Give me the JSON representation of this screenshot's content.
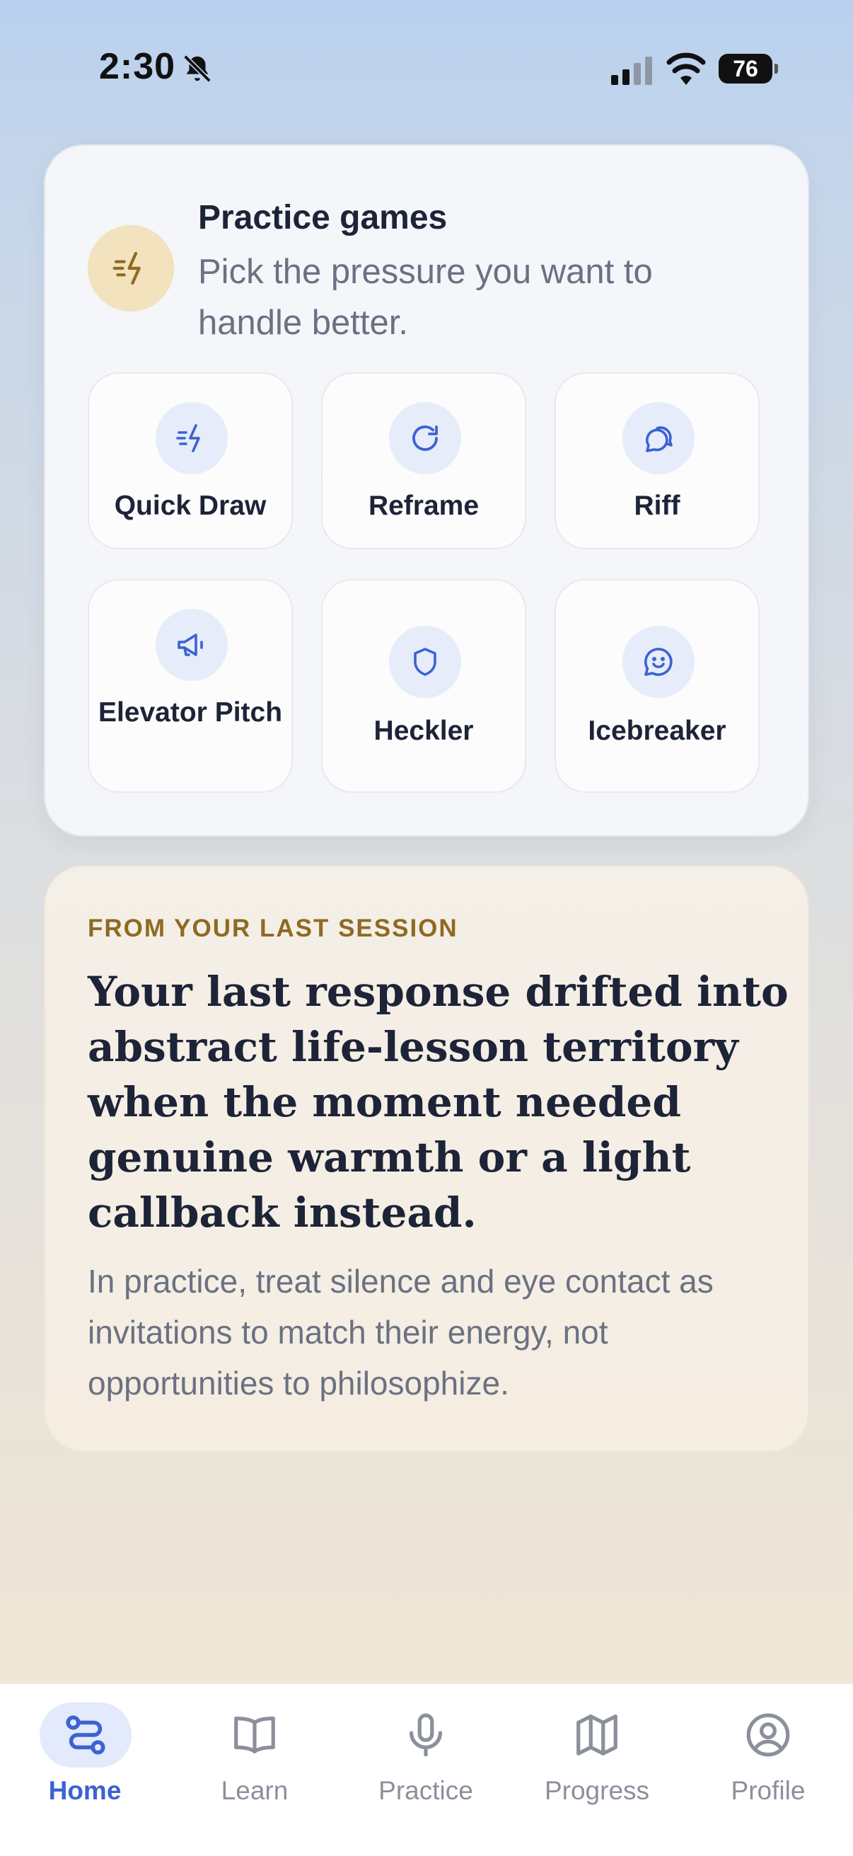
{
  "status_bar": {
    "time": "2:30",
    "battery": "76",
    "icons": [
      "bell-slash-icon",
      "cellular-signal-icon",
      "wifi-icon",
      "battery-icon"
    ]
  },
  "games": {
    "title": "Practice games",
    "subtitle": "Pick the pressure you want to handle better.",
    "header_icon": "bolt-lines-icon",
    "tiles": [
      {
        "label": "Quick Draw",
        "icon": "bolt-lines-icon"
      },
      {
        "label": "Reframe",
        "icon": "refresh-icon"
      },
      {
        "label": "Riff",
        "icon": "chat-bubbles-icon"
      },
      {
        "label": "Elevator Pitch",
        "icon": "megaphone-icon"
      },
      {
        "label": "Heckler",
        "icon": "shield-icon"
      },
      {
        "label": "Icebreaker",
        "icon": "smile-chat-icon"
      }
    ]
  },
  "session": {
    "eyebrow": "FROM YOUR LAST SESSION",
    "headline": "Your last response drifted into abstract life-lesson territory when the moment needed genuine warmth or a light callback instead.",
    "body": "In practice, treat silence and eye contact as invitations to match their energy, not opportunities to philosophize."
  },
  "nav": {
    "items": [
      {
        "label": "Home",
        "icon": "route-icon",
        "active": true
      },
      {
        "label": "Learn",
        "icon": "book-icon",
        "active": false
      },
      {
        "label": "Practice",
        "icon": "microphone-icon",
        "active": false
      },
      {
        "label": "Progress",
        "icon": "map-icon",
        "active": false
      },
      {
        "label": "Profile",
        "icon": "user-circle-icon",
        "active": false
      }
    ]
  },
  "colors": {
    "accent": "#3b63d1",
    "eyebrow": "#8e6a22",
    "header_icon_bg": "#f2e2bd",
    "tile_icon_bg": "#e6ecfa",
    "nav_active_pill": "#e3eafb"
  }
}
